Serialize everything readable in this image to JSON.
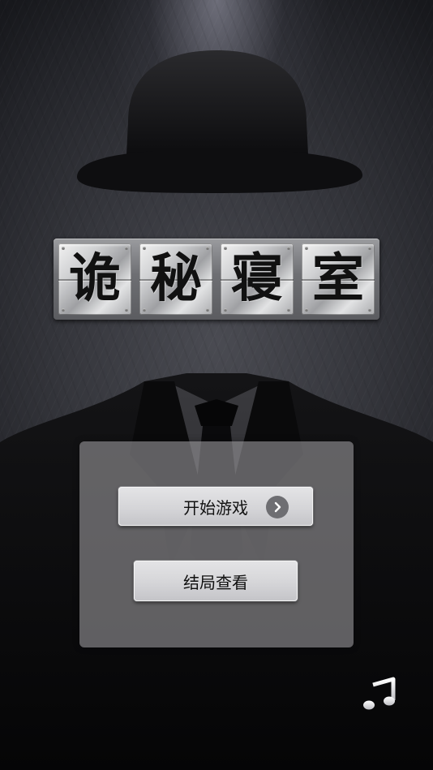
{
  "title": {
    "characters": [
      "诡",
      "秘",
      "寝",
      "室"
    ]
  },
  "menu": {
    "start_label": "开始游戏",
    "ending_label": "结局查看"
  },
  "icons": {
    "start_arrow": "chevron-right-icon",
    "music": "music-note-icon"
  },
  "colors": {
    "background": "#2c2d33",
    "panel": "#969498",
    "button": "#d8d8db",
    "text": "#111111"
  }
}
